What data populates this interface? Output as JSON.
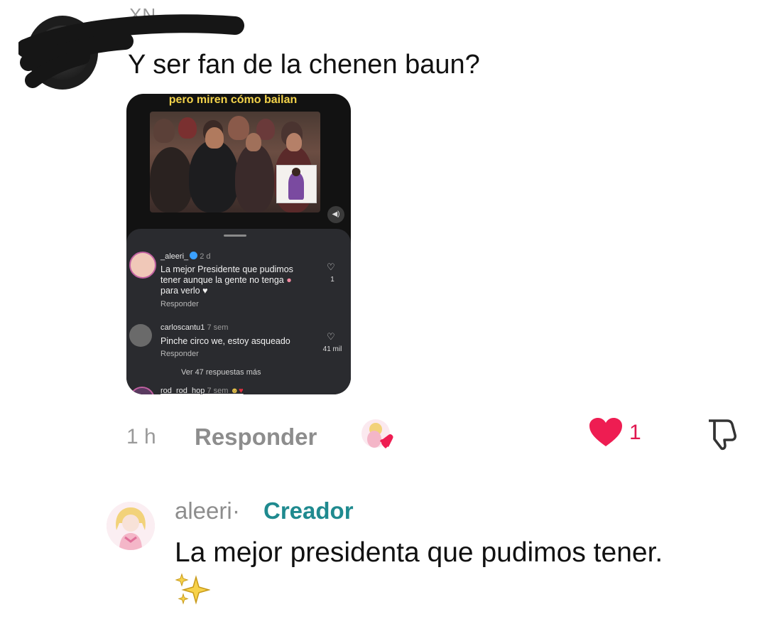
{
  "top_comment": {
    "username": "XN",
    "text": "Y ser fan de la chenen baun?"
  },
  "embedded_screenshot": {
    "caption": "pero miren cómo bailan",
    "comments": [
      {
        "username": "_aleeri_",
        "time": "2 d",
        "text_lines": [
          "La mejor Presidente que pudimos",
          "tener aunque la gente no tenga",
          "para verlo"
        ],
        "reply_label": "Responder",
        "likes": "1"
      },
      {
        "username": "carloscantu1",
        "time": "7 sem",
        "text_lines": [
          "Pinche circo we, estoy asqueado"
        ],
        "reply_label": "Responder",
        "likes": "41 mil"
      },
      {
        "username": "rod_rod_hop",
        "time": "7 sem",
        "text_lines": [],
        "reply_label": "",
        "likes": ""
      }
    ],
    "more_replies": "Ver 47 respuestas más"
  },
  "actions": {
    "time": "1 h",
    "reply_label": "Responder",
    "like_count": "1",
    "like_color": "#ee1d52"
  },
  "reply": {
    "username": "aleeri",
    "separator": "·",
    "badge": "Creador",
    "badge_color": "#1f8a8f",
    "text": "La mejor presidenta que pudimos tener.",
    "emoji": "✨"
  }
}
